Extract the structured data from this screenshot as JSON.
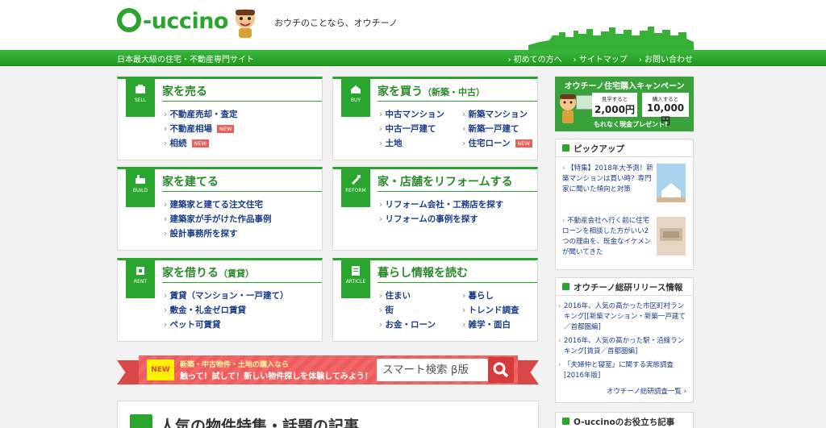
{
  "header": {
    "logo_text": "O-uccino",
    "logo_rest": "-uccino",
    "tagline": "おウチのことなら、オウチーノ",
    "subtitle": "日本最大級の住宅・不動産専門サイト",
    "links": [
      "初めての方へ",
      "サイトマップ",
      "お問い合わせ"
    ]
  },
  "categories": [
    {
      "id": "sell",
      "badge": "SELL",
      "title": "家を売る",
      "title_sub": "",
      "col1": [
        {
          "label": "不動産売却・査定",
          "new": false
        },
        {
          "label": "不動産相場",
          "new": true
        },
        {
          "label": "相続",
          "new": true
        }
      ],
      "col2": []
    },
    {
      "id": "buy",
      "badge": "BUY",
      "title": "家を買う",
      "title_sub": "（新築・中古）",
      "col1": [
        {
          "label": "中古マンション",
          "new": false
        },
        {
          "label": "中古一戸建て",
          "new": false
        },
        {
          "label": "土地",
          "new": false
        }
      ],
      "col2": [
        {
          "label": "新築マンション",
          "new": false
        },
        {
          "label": "新築一戸建て",
          "new": false
        },
        {
          "label": "住宅ローン",
          "new": true
        }
      ]
    },
    {
      "id": "build",
      "badge": "BUILD",
      "title": "家を建てる",
      "title_sub": "",
      "col1": [
        {
          "label": "建築家と建てる注文住宅",
          "new": false
        },
        {
          "label": "建築家が手がけた作品事例",
          "new": false
        },
        {
          "label": "設計事務所を探す",
          "new": false
        }
      ],
      "col2": []
    },
    {
      "id": "reform",
      "badge": "REFORM",
      "title": "家・店舗をリフォームする",
      "title_sub": "",
      "col1": [
        {
          "label": "リフォーム会社・工務店を探す",
          "new": false
        },
        {
          "label": "リフォームの事例を探す",
          "new": false
        }
      ],
      "col2": []
    },
    {
      "id": "rent",
      "badge": "RENT",
      "title": "家を借りる",
      "title_sub": "（賃貸）",
      "col1": [
        {
          "label": "賃貸（マンション・一戸建て）",
          "new": false
        },
        {
          "label": "敷金・礼金ゼロ賃貸",
          "new": false
        },
        {
          "label": "ペット可賃貸",
          "new": false
        }
      ],
      "col2": []
    },
    {
      "id": "article",
      "badge": "ARTICLE",
      "title": "暮らし情報を読む",
      "title_sub": "",
      "col1": [
        {
          "label": "住まい",
          "new": false
        },
        {
          "label": "街",
          "new": false
        },
        {
          "label": "お金・ローン",
          "new": false
        }
      ],
      "col2": [
        {
          "label": "暮らし",
          "new": false
        },
        {
          "label": "トレンド調査",
          "new": false
        },
        {
          "label": "雑学・面白",
          "new": false
        }
      ]
    }
  ],
  "new_label": "NEW",
  "banner": {
    "new": "NEW",
    "line1": "新築・中古物件・土地の購入なら",
    "line2": "触って！試して！新しい物件探しを体験してみよう！",
    "search": "スマート検索 β版"
  },
  "feature": {
    "title": "人気の物件特集・話題の記事"
  },
  "sidebar": {
    "campaign": {
      "title": "オウチーノ住宅購入キャンペーン",
      "box1_small": "見学すると",
      "box1_big": "2,000円",
      "box2_small": "購入すると",
      "box2_big": "10,000円",
      "footer": "もれなく現金プレゼント!"
    },
    "pickup": {
      "title": "ピックアップ",
      "items": [
        "【特集】2018年大予測！新築マンションは買い時？専門家に聞いた傾向と対策",
        "不動産会社へ行く前に住宅ローンを相談した方がいい2つの理由を、既金なイケメンが聞いてきた"
      ]
    },
    "release": {
      "title": "オウチーノ総研リリース情報",
      "items": [
        "2016年、人気の高かった市区町村ランキング[[新築マンション・新築一戸建て／首都圏編]",
        "2016年、人気の高かった駅・沿線ランキング[賃貸／首都圏編]",
        "「夫婦仲と寝室」に関する実態調査[2016年版]"
      ],
      "more": "オウチーノ総研調査一覧 ›"
    },
    "useful": {
      "title": "O-uccinoのお役立ち記事"
    }
  },
  "colors": {
    "brand_green": "#2aa52d",
    "link_blue": "#1a3d8a",
    "new_red": "#e8605a",
    "banner_red": "#f06868"
  }
}
